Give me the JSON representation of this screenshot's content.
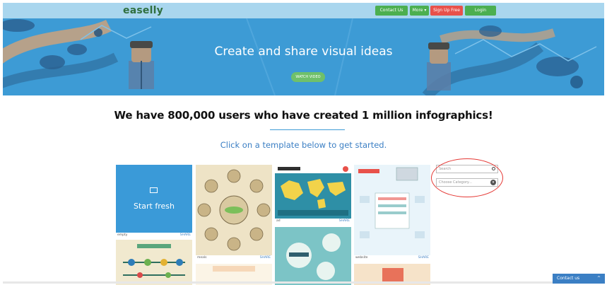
{
  "nav": {
    "logo": "easelly",
    "contact": "Contact Us",
    "more": "More ▾",
    "signup": "Sign Up Free",
    "login": "Login"
  },
  "hero": {
    "title": "Create and share visual ideas",
    "watch": "WATCH VIDEO"
  },
  "main": {
    "headline": "We have 800,000 users who have created 1 million infographics!",
    "subline": "Click on a template below to get started."
  },
  "templates": [
    {
      "name": "empty",
      "label": "Start fresh",
      "share": "SHARE"
    },
    {
      "name": "meals",
      "share": "SHARE"
    },
    {
      "name": "ad",
      "share": "SHARE"
    },
    {
      "name": "website",
      "share": "SHARE"
    }
  ],
  "sidebar": {
    "search_placeholder": "Search",
    "category_placeholder": "Choose Category...",
    "chevron": "▾"
  },
  "widget": {
    "contact": "Contact us",
    "caret": "^"
  },
  "colors": {
    "hero": "#3d9bd5",
    "nav": "#a9d6ee",
    "green": "#4caf50",
    "red": "#e8514a",
    "link_blue": "#3b7fc4"
  }
}
